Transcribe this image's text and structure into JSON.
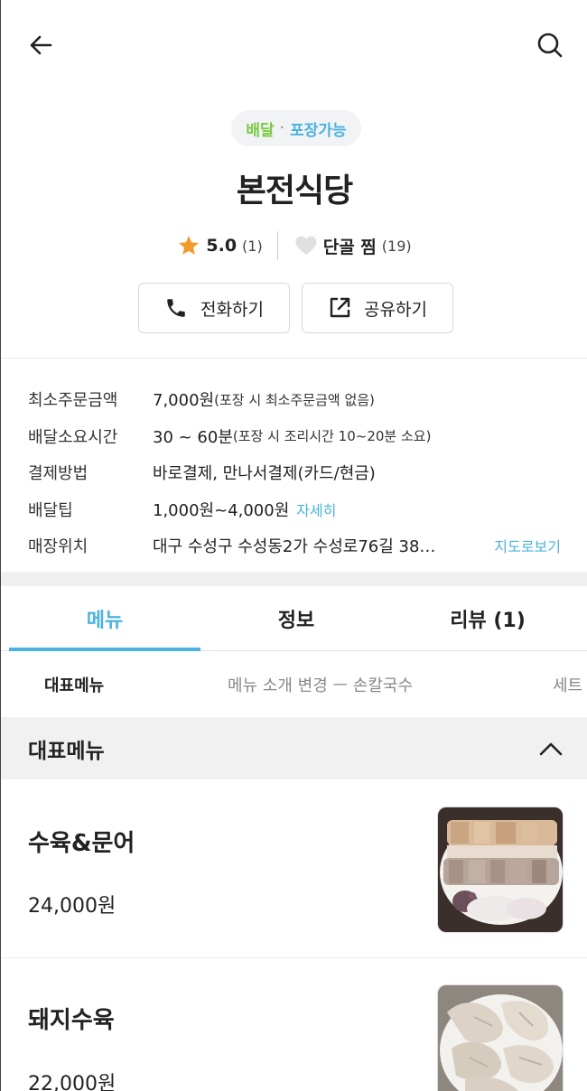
{
  "store": {
    "service_delivery": "배달",
    "service_separator": "·",
    "service_takeout": "포장가능",
    "name": "본전식당",
    "rating": "5.0",
    "rating_count": "(1)",
    "favorite_label": "단골 찜",
    "favorite_count": "(19)"
  },
  "actions": {
    "call_label": "전화하기",
    "share_label": "공유하기"
  },
  "info": {
    "min_order_label": "최소주문금액",
    "min_order_value": "7,000원",
    "min_order_note": "(포장 시 최소주문금액 없음)",
    "delivery_time_label": "배달소요시간",
    "delivery_time_value": "30 ~ 60분",
    "delivery_time_note": "(포장 시 조리시간 10~20분 소요)",
    "payment_label": "결제방법",
    "payment_value": "바로결제, 만나서결제(카드/현금)",
    "tip_label": "배달팁",
    "tip_value": "1,000원~4,000원",
    "tip_link": "자세히",
    "location_label": "매장위치",
    "location_value": "대구 수성구 수성동2가 수성로76길 38…",
    "map_link": "지도로보기"
  },
  "tabs": [
    {
      "label": "메뉴",
      "active": true
    },
    {
      "label": "정보",
      "active": false
    },
    {
      "label": "리뷰 (1)",
      "active": false
    }
  ],
  "categories": [
    {
      "label": "대표메뉴",
      "active": true
    },
    {
      "label": "메뉴 소개 변경 ㅡ 손칼국수",
      "active": false
    },
    {
      "label": "세트",
      "active": false
    }
  ],
  "section": {
    "title": "대표메뉴"
  },
  "menu_items": [
    {
      "name": "수육&문어",
      "price": "24,000원"
    },
    {
      "name": "돼지수육",
      "price": "22,000원"
    }
  ],
  "colors": {
    "accent": "#4bb3e0",
    "delivery_green": "#7ac943",
    "star": "#f39a2b"
  },
  "icons": [
    "back-arrow-icon",
    "search-icon",
    "star-icon",
    "heart-icon",
    "phone-icon",
    "share-icon",
    "chevron-up-icon"
  ]
}
